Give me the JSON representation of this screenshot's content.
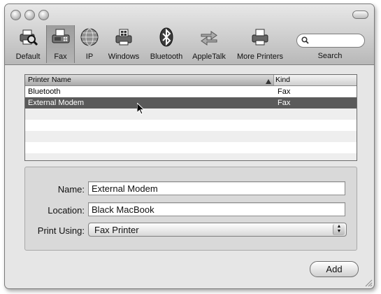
{
  "toolbar": {
    "items": [
      {
        "label": "Default",
        "icon": "printer-magnifier-icon"
      },
      {
        "label": "Fax",
        "icon": "fax-icon"
      },
      {
        "label": "IP",
        "icon": "globe-icon"
      },
      {
        "label": "Windows",
        "icon": "windows-printer-icon"
      },
      {
        "label": "Bluetooth",
        "icon": "bluetooth-icon"
      },
      {
        "label": "AppleTalk",
        "icon": "appletalk-arrows-icon"
      },
      {
        "label": "More Printers",
        "icon": "printer-icon"
      }
    ],
    "selected": "Fax",
    "search_label": "Search",
    "search_placeholder": ""
  },
  "printer_list": {
    "columns": {
      "name": "Printer Name",
      "kind": "Kind"
    },
    "sort_indicator": "▲",
    "rows": [
      {
        "name": "Bluetooth",
        "kind": "Fax"
      },
      {
        "name": "External Modem",
        "kind": "Fax"
      }
    ],
    "selected_row": 1
  },
  "details": {
    "name_label": "Name:",
    "name_value": "External Modem",
    "location_label": "Location:",
    "location_value": "Black MacBook",
    "print_using_label": "Print Using:",
    "print_using_value": "Fax Printer"
  },
  "add_button": "Add",
  "colors": {
    "selection": "#5a5a5a",
    "toolbar_top": "#e8e8e8",
    "toolbar_bottom": "#b8b8b8"
  }
}
